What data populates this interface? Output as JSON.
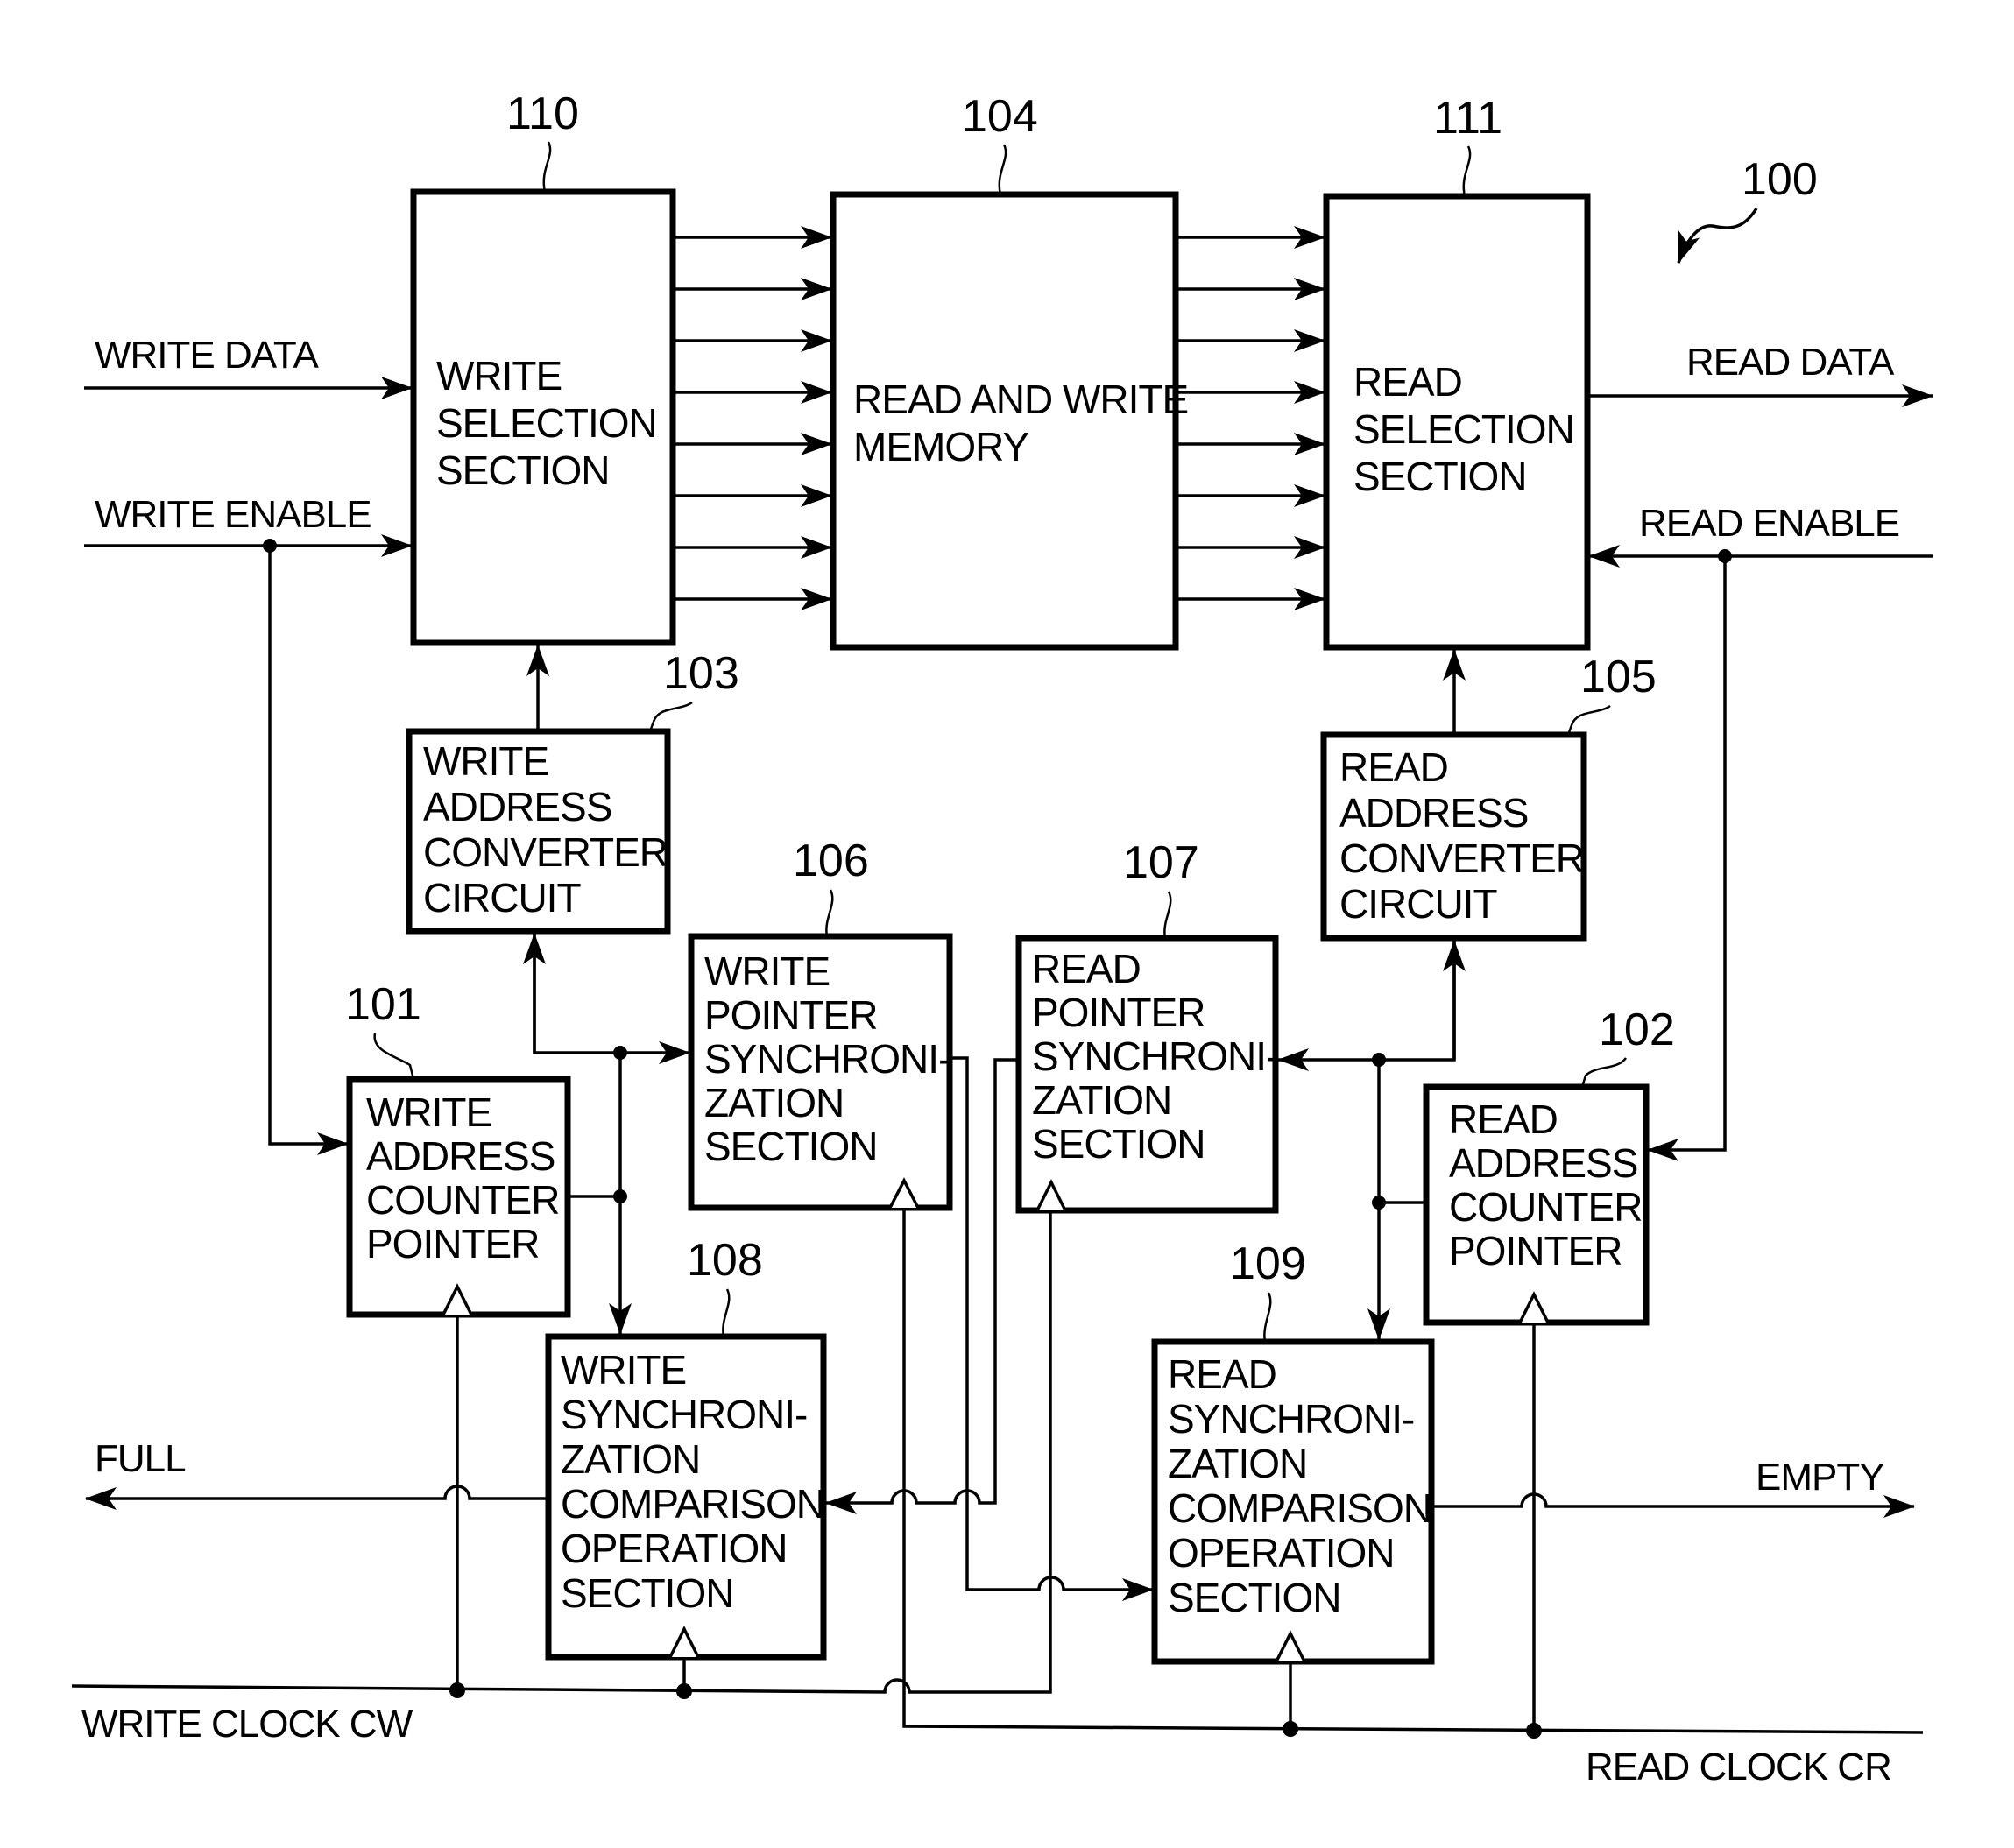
{
  "figure": {
    "reference": "100",
    "colors": {
      "ink": "#000000",
      "background": "#ffffff"
    }
  },
  "blocks": {
    "write_selection": {
      "ref": "110",
      "lines": [
        "WRITE",
        "SELECTION",
        "SECTION"
      ]
    },
    "memory": {
      "ref": "104",
      "lines": [
        "READ AND WRITE",
        "MEMORY"
      ]
    },
    "read_selection": {
      "ref": "111",
      "lines": [
        "READ",
        "SELECTION",
        "SECTION"
      ]
    },
    "write_addr_converter": {
      "ref": "103",
      "lines": [
        "WRITE",
        "ADDRESS",
        "CONVERTER",
        "CIRCUIT"
      ]
    },
    "read_addr_converter": {
      "ref": "105",
      "lines": [
        "READ",
        "ADDRESS",
        "CONVERTER",
        "CIRCUIT"
      ]
    },
    "write_ptr_sync": {
      "ref": "106",
      "lines": [
        "WRITE",
        "POINTER",
        "SYNCHRONI-",
        "ZATION",
        "SECTION"
      ]
    },
    "read_ptr_sync": {
      "ref": "107",
      "lines": [
        "READ",
        "POINTER",
        "SYNCHRONI-",
        "ZATION",
        "SECTION"
      ]
    },
    "write_addr_counter": {
      "ref": "101",
      "lines": [
        "WRITE",
        "ADDRESS",
        "COUNTER",
        "POINTER"
      ]
    },
    "read_addr_counter": {
      "ref": "102",
      "lines": [
        "READ",
        "ADDRESS",
        "COUNTER",
        "POINTER"
      ]
    },
    "write_sync_compare": {
      "ref": "108",
      "lines": [
        "WRITE",
        "SYNCHRONI-",
        "ZATION",
        "COMPARISON",
        "OPERATION",
        "SECTION"
      ]
    },
    "read_sync_compare": {
      "ref": "109",
      "lines": [
        "READ",
        "SYNCHRONI-",
        "ZATION",
        "COMPARISON",
        "OPERATION",
        "SECTION"
      ]
    }
  },
  "signals": {
    "write_data": "WRITE DATA",
    "write_enable": "WRITE ENABLE",
    "read_data": "READ DATA",
    "read_enable": "READ ENABLE",
    "full": "FULL",
    "empty": "EMPTY",
    "write_clock": "WRITE CLOCK CW",
    "read_clock": "READ CLOCK CR"
  },
  "bus": {
    "parallel_lines": 8
  }
}
